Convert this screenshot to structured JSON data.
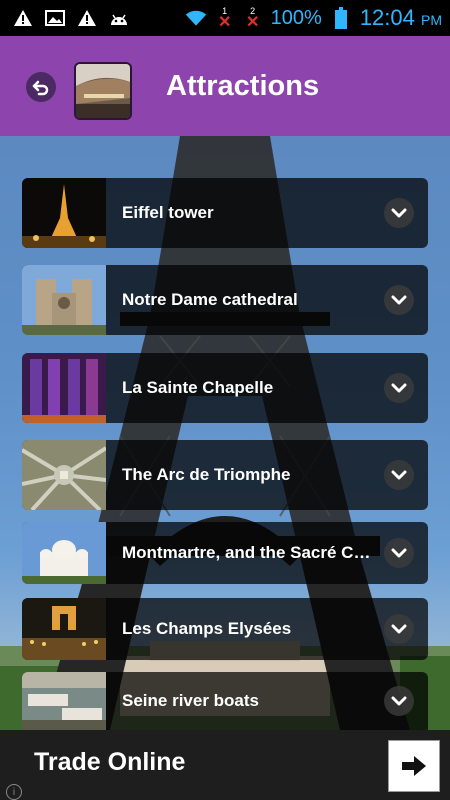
{
  "status_bar": {
    "battery_percent": "100%",
    "time": "12:04",
    "ampm": "PM",
    "sim1": "1",
    "sim2": "2",
    "icons": [
      "warning-icon",
      "image-icon",
      "warning-icon",
      "android-icon",
      "wifi-icon",
      "signal-x-icon",
      "signal-x-icon",
      "battery-icon"
    ]
  },
  "app_bar": {
    "title": "Attractions",
    "color": "#8e44ad"
  },
  "attractions": [
    {
      "label": "Eiffel tower"
    },
    {
      "label": "Notre Dame cathedral"
    },
    {
      "label": "La Sainte Chapelle"
    },
    {
      "label": "The Arc de Triomphe"
    },
    {
      "label": "Montmartre, and the Sacré Coeur"
    },
    {
      "label": "Les Champs Elysées"
    },
    {
      "label": "Seine river boats"
    }
  ],
  "ad": {
    "text": "Trade Online",
    "info": "i"
  }
}
